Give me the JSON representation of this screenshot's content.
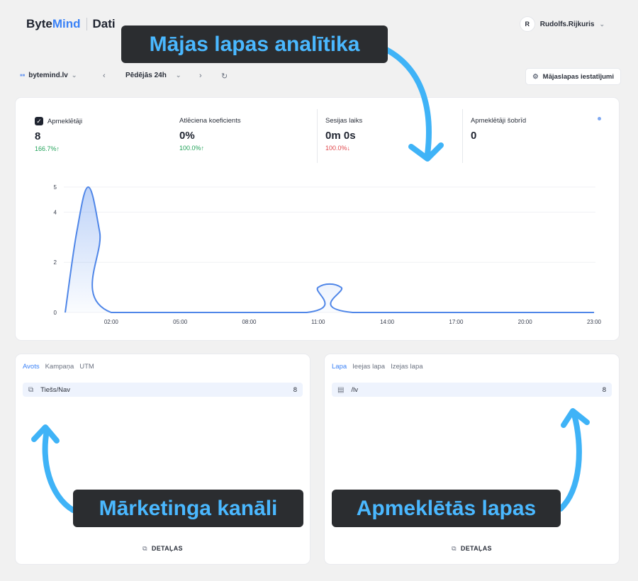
{
  "brand": {
    "name_part1": "Byte",
    "name_part2": "Mind",
    "section": "Dati"
  },
  "user": {
    "initial": "R",
    "name": "Rudolfs.Rijkuris"
  },
  "toolbar": {
    "site": "bytemind.lv",
    "period": "Pēdējās 24h",
    "prev_icon": "‹",
    "next_icon": "›",
    "refresh_icon": "↻",
    "settings_label": "Mājaslapas iestatījumi"
  },
  "metrics": [
    {
      "label": "Apmeklētāji",
      "value": "8",
      "change": "166.7%↑",
      "trend": "up"
    },
    {
      "label": "Atlēciena koeficients",
      "value": "0%",
      "change": "100.0%↑",
      "trend": "up"
    },
    {
      "label": "Sesijas laiks",
      "value": "0m 0s",
      "change": "100.0%↓",
      "trend": "down"
    },
    {
      "label": "Apmeklētāji šobrīd",
      "value": "0",
      "change": "",
      "trend": ""
    }
  ],
  "chart_data": {
    "type": "area",
    "y_ticks": [
      "0",
      "2",
      "4",
      "5"
    ],
    "x_ticks": [
      "02:00",
      "05:00",
      "08:00",
      "11:00",
      "14:00",
      "17:00",
      "20:00",
      "23:00"
    ],
    "ylim": [
      0,
      5
    ],
    "x_hours": [
      0.0,
      0.5,
      1.0,
      1.5,
      2.0,
      10.5,
      11.0,
      12.0,
      12.5,
      23.0
    ],
    "values": [
      0,
      3.2,
      5,
      3.2,
      0,
      0,
      1,
      1,
      0,
      0
    ],
    "color": "#4f86e8"
  },
  "sources": {
    "tabs": [
      "Avots",
      "Kampaņa",
      "UTM"
    ],
    "rows": [
      {
        "label": "Tiešs/Nav",
        "value": "8"
      }
    ],
    "details": "DETAĻAS"
  },
  "pages": {
    "tabs": [
      "Lapa",
      "Ieejas lapa",
      "Izejas lapa"
    ],
    "rows": [
      {
        "label": "/lv",
        "value": "8"
      }
    ],
    "details": "DETAĻAS"
  },
  "callouts": {
    "analytics": "Mājas lapas analītika",
    "marketing": "Mārketinga kanāli",
    "visited": "Apmeklētās lapas"
  }
}
